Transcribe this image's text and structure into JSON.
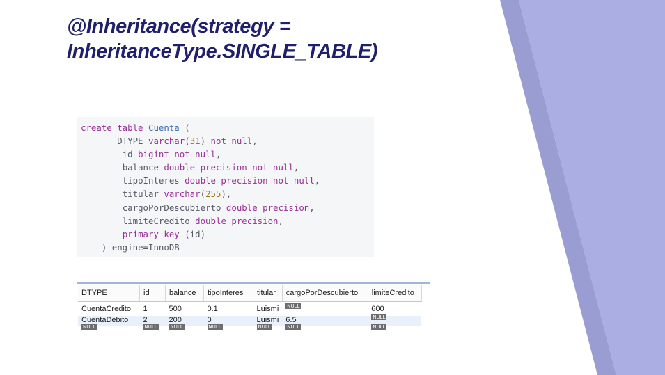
{
  "slide": {
    "title_line1": "@Inheritance(strategy =",
    "title_line2": "InheritanceType.SINGLE_TABLE)"
  },
  "code": {
    "l1_kw": "create table",
    "l1_name": "Cuenta",
    "l1_paren": " (",
    "l2_col": "DTYPE",
    "l2_type": "varchar",
    "l2_size": "31",
    "l2_close": ")",
    "l2_mod": "not null",
    "l3_col": "id",
    "l3_type": "bigint",
    "l3_mod": "not null",
    "l4_col": "balance",
    "l4_type": "double precision",
    "l4_mod": "not null",
    "l5_col": "tipoInteres",
    "l5_type": "double precision",
    "l5_mod": "not null",
    "l6_col": "titular",
    "l6_type": "varchar",
    "l6_size": "255",
    "l6_close": "),",
    "l7_col": "cargoPorDescubierto",
    "l7_type": "double precision",
    "l8_col": "limiteCredito",
    "l8_type": "double precision",
    "l9_kw": "primary key",
    "l9_rest": " (id)",
    "l10": ") engine=InnoDB"
  },
  "table": {
    "headers": [
      "DTYPE",
      "id",
      "balance",
      "tipoInteres",
      "titular",
      "cargoPorDescubierto",
      "limiteCredito"
    ],
    "null_label": "NULL",
    "rows": [
      [
        "CuentaCredito",
        "1",
        "500",
        "0.1",
        "Luismi",
        "NULL",
        "600"
      ],
      [
        "CuentaDebito",
        "2",
        "200",
        "0",
        "Luismi",
        "6.5",
        "NULL"
      ],
      [
        "NULL",
        "NULL",
        "NULL",
        "NULL",
        "NULL",
        "NULL",
        "NULL"
      ]
    ]
  },
  "colors": {
    "title": "#1f1f6b",
    "deco_light": "#aaaee2",
    "deco_dark": "#8f92c9",
    "code_bg": "#f5f6f8",
    "keyword": "#9a2f9a",
    "table_name": "#3d6fb0"
  }
}
